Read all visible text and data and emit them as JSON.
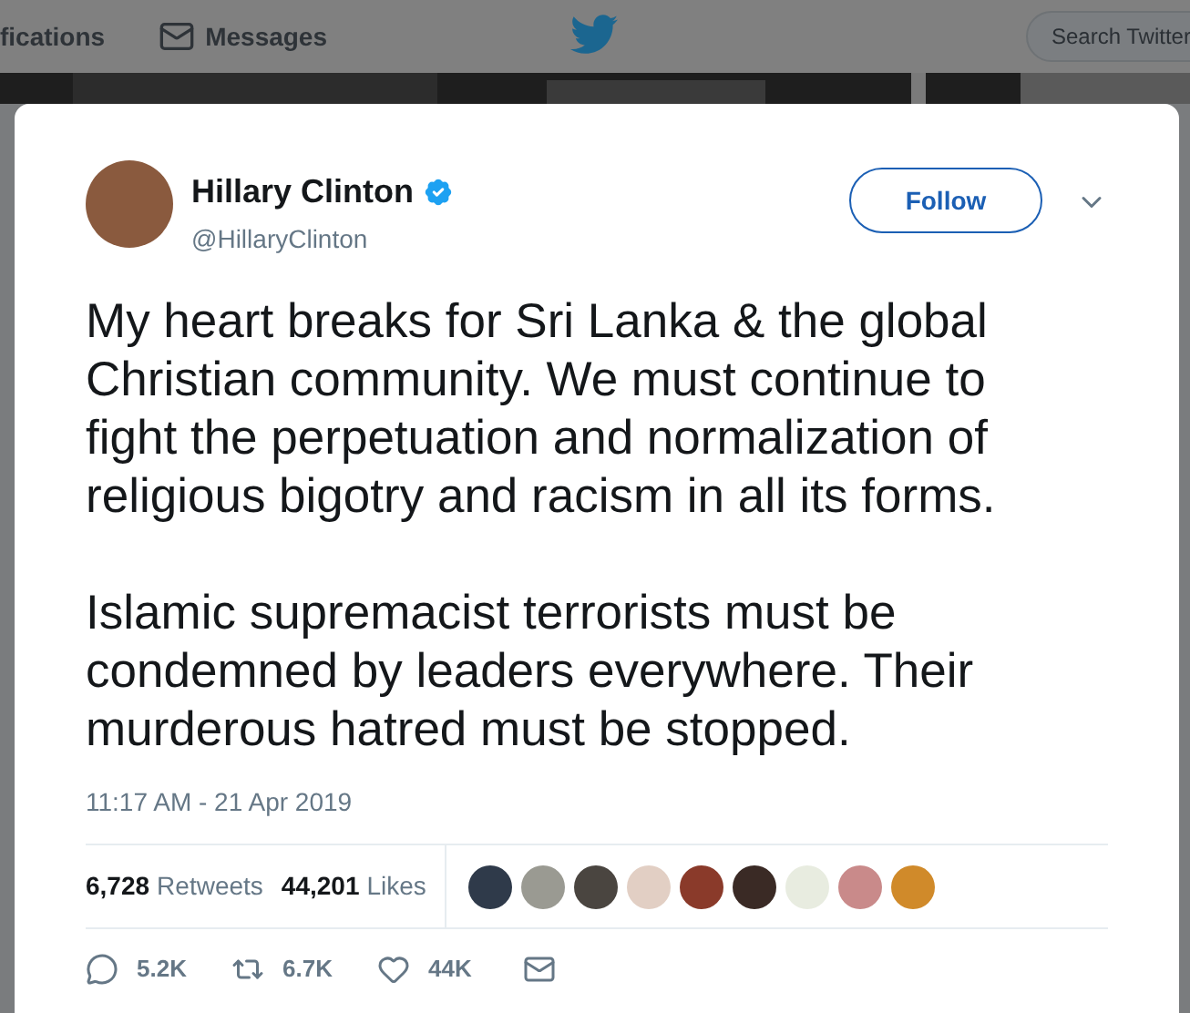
{
  "nav": {
    "items": [
      "fications",
      "Messages"
    ],
    "search": {
      "placeholder": "Search Twitter"
    }
  },
  "tweet": {
    "name": "Hillary Clinton",
    "verified": true,
    "handle": "@HillaryClinton",
    "follow": "Follow",
    "paragraphs": [
      "My heart breaks for Sri Lanka & the global Christian community. We must continue to fight the perpetuation and normalization of religious bigotry and racism in all its forms.",
      "Islamic supremacist terrorists must be condemned by leaders everywhere. Their murderous hatred must be stopped."
    ],
    "timestamp": "11:17 AM - 21 Apr 2019",
    "stats": [
      {
        "count": "6,728",
        "label": "Retweets"
      },
      {
        "count": "44,201",
        "label": "Likes"
      }
    ],
    "likers": [
      {
        "color": "#2f3a4a"
      },
      {
        "color": "#9a9a92"
      },
      {
        "color": "#4a4540"
      },
      {
        "color": "#e2cfc4"
      },
      {
        "color": "#8a3a2a"
      },
      {
        "color": "#3a2a25"
      },
      {
        "color": "#e8ece0"
      },
      {
        "color": "#c98a8a"
      },
      {
        "color": "#d08a2a"
      }
    ],
    "actions": [
      {
        "kind": "reply",
        "count": "5.2K"
      },
      {
        "kind": "retweet",
        "count": "6.7K"
      },
      {
        "kind": "like",
        "count": "44K"
      },
      {
        "kind": "message"
      }
    ]
  }
}
